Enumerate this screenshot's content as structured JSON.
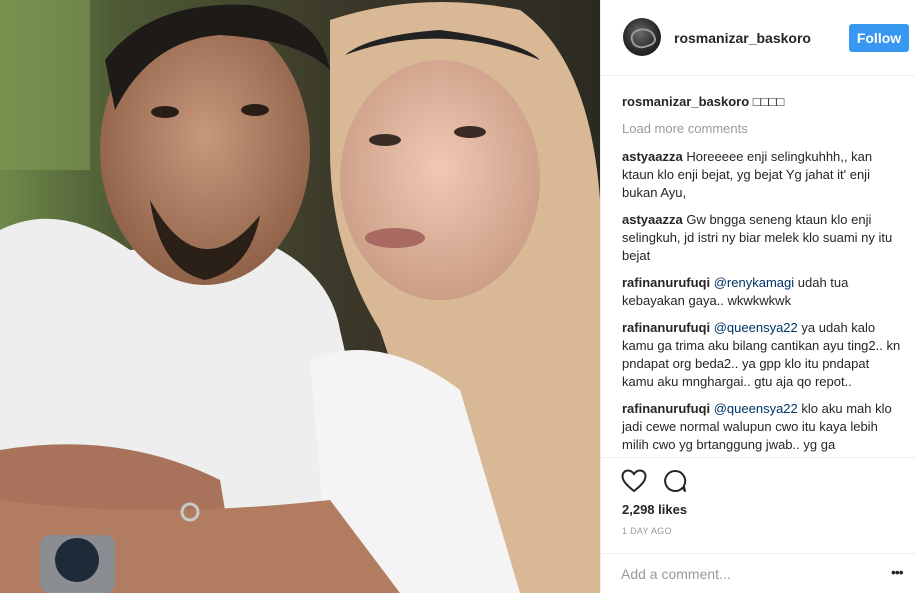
{
  "post": {
    "username": "rosmanizar_baskoro",
    "follow_label": "Follow",
    "caption": {
      "user": "rosmanizar_baskoro",
      "text": "□□□□"
    },
    "load_more": "Load more comments",
    "comments": [
      {
        "user": "astyaazza",
        "mention": "",
        "text": "Horeeeee enji selingkuhhh,, kan ktaun klo enji bejat, yg bejat Yg jahat it' enji bukan Ayu,"
      },
      {
        "user": "astyaazza",
        "mention": "",
        "text": "Gw bngga seneng ktaun klo enji selingkuh, jd istri ny biar melek klo suami ny itu bejat"
      },
      {
        "user": "rafinanurufuqi",
        "mention": "@renykamagi",
        "text": "udah tua kebayakan gaya.. wkwkwkwk"
      },
      {
        "user": "rafinanurufuqi",
        "mention": "@queensya22",
        "text": "ya udah kalo kamu ga trima aku bilang cantikan ayu ting2.. kn pndapat org beda2.. ya gpp klo itu pndapat kamu aku mnghargai.. gtu aja qo repot.."
      },
      {
        "user": "rafinanurufuqi",
        "mention": "@queensya22",
        "text": "klo aku mah klo jadi cewe normal walupun cwo itu kaya lebih milih cwo yg brtanggung jwab.. yg ga"
      }
    ],
    "likes": "2,298 likes",
    "timestamp": "1 DAY AGO",
    "comment_placeholder": "Add a comment...",
    "more_options": "•••",
    "accent_color": "#3897f0"
  }
}
